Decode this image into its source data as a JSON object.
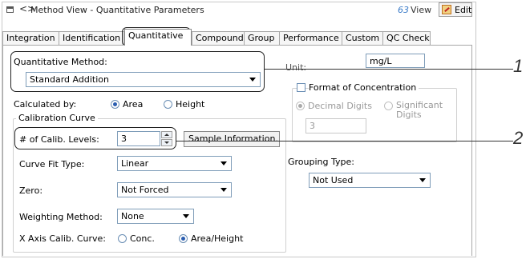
{
  "window": {
    "title": "Method View - Quantitative Parameters",
    "nav": "<>",
    "view_label": "View",
    "edit_label": "Edit"
  },
  "tabs": [
    "Integration",
    "Identification",
    "Quantitative",
    "Compound",
    "Group",
    "Performance",
    "Custom",
    "QC Check"
  ],
  "active_tab": "Quantitative",
  "quant": {
    "method_label": "Quantitative Method:",
    "method_value": "Standard Addition",
    "calculated_by_label": "Calculated by:",
    "area_label": "Area",
    "height_label": "Height",
    "calculated_by_selected": "Area"
  },
  "calibration": {
    "legend": "Calibration Curve",
    "levels_label": "# of Calib. Levels:",
    "levels_value": "3",
    "sample_info_button": "Sample Information...",
    "curve_fit_label": "Curve Fit Type:",
    "curve_fit_value": "Linear",
    "zero_label": "Zero:",
    "zero_value": "Not Forced",
    "weighting_label": "Weighting Method:",
    "weighting_value": "None",
    "x_axis_label": "X Axis Calib. Curve:",
    "conc_label": "Conc.",
    "area_height_label": "Area/Height",
    "x_axis_selected": "Area/Height"
  },
  "unit": {
    "label": "Unit:",
    "value": "mg/L"
  },
  "format": {
    "checkbox_label": "Format of Concentration",
    "checked": false,
    "decimal_label": "Decimal Digits",
    "significant_label": "Significant Digits",
    "digits_value": "3"
  },
  "grouping": {
    "label": "Grouping Type:",
    "value": "Not Used"
  },
  "callouts": [
    "1",
    "2"
  ]
}
